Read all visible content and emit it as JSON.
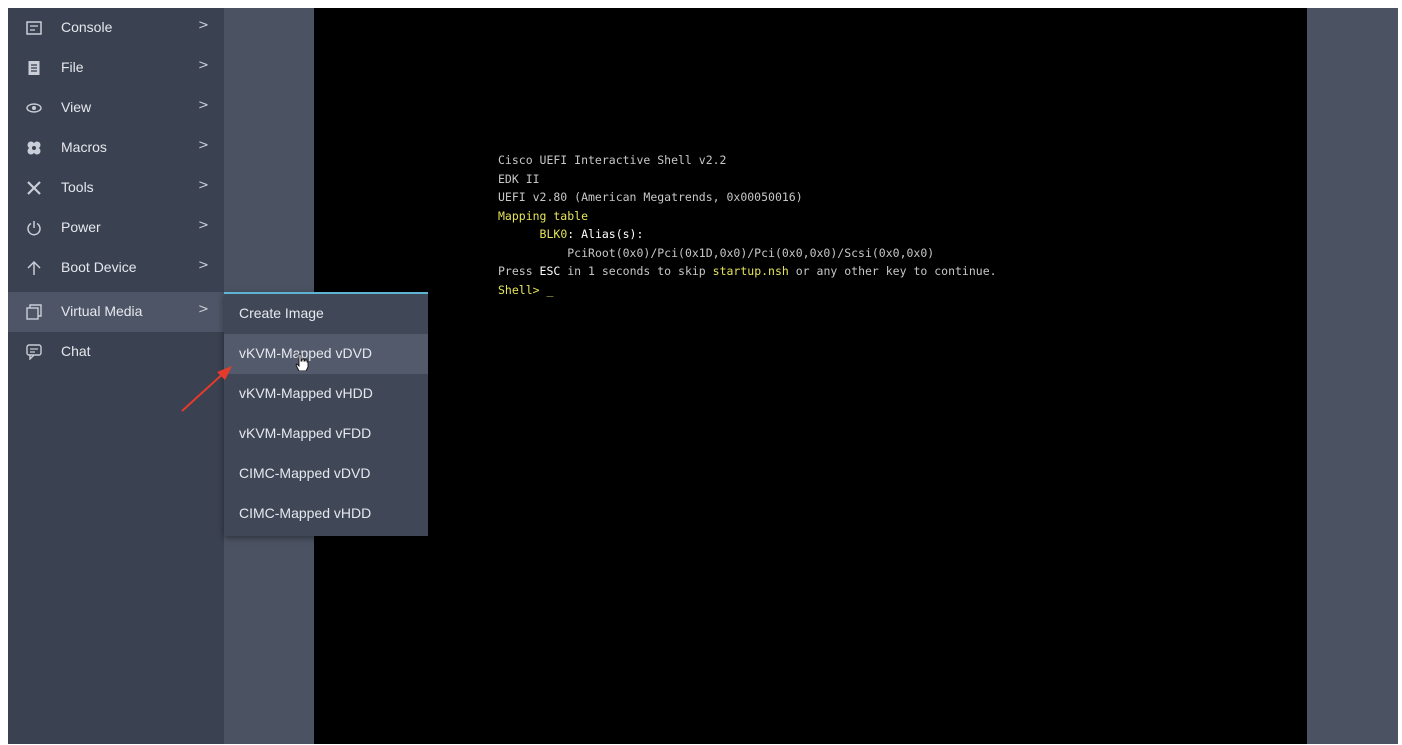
{
  "sidebar": {
    "items": [
      {
        "label": "Console",
        "icon": "console-icon",
        "chevron": ">"
      },
      {
        "label": "File",
        "icon": "file-icon",
        "chevron": ">"
      },
      {
        "label": "View",
        "icon": "eye-icon",
        "chevron": ">"
      },
      {
        "label": "Macros",
        "icon": "macros-icon",
        "chevron": ">"
      },
      {
        "label": "Tools",
        "icon": "tools-icon",
        "chevron": ">"
      },
      {
        "label": "Power",
        "icon": "power-icon",
        "chevron": ">"
      },
      {
        "label": "Boot Device",
        "icon": "up-arrow-icon",
        "chevron": ">"
      },
      {
        "label": "Virtual Media",
        "icon": "virtual-media-icon",
        "chevron": ">",
        "active": true
      },
      {
        "label": "Chat",
        "icon": "chat-icon"
      }
    ]
  },
  "submenu": {
    "items": [
      {
        "label": "Create Image"
      },
      {
        "label": "vKVM-Mapped vDVD",
        "hovered": true
      },
      {
        "label": "vKVM-Mapped vHDD"
      },
      {
        "label": "vKVM-Mapped vFDD"
      },
      {
        "label": "CIMC-Mapped vDVD"
      },
      {
        "label": "CIMC-Mapped vHDD"
      }
    ]
  },
  "terminal": {
    "line1": "Cisco UEFI Interactive Shell v2.2",
    "line2": "EDK II",
    "line3": "UEFI v2.80 (American Megatrends, 0x00050016)",
    "line4": "Mapping table",
    "line5_label": "BLK0",
    "line5_rest": ": Alias(s):",
    "line6": "PciRoot(0x0)/Pci(0x1D,0x0)/Pci(0x0,0x0)/Scsi(0x0,0x0)",
    "line7_press": "Press ",
    "line7_esc": "ESC",
    "line7_mid": " in 1 seconds to skip ",
    "line7_file": "startup.nsh",
    "line7_end": " or any other key to continue.",
    "prompt": "Shell> ",
    "cursor": "_"
  },
  "colors": {
    "sidebar_bg": "#3a4150",
    "panel_bg": "#4b5363",
    "terminal_bg": "#000000",
    "terminal_text": "#c7c7c7",
    "terminal_highlight": "#e6e45a",
    "submenu_accent": "#5fb4d6",
    "annotation_arrow": "#e53a2c"
  }
}
